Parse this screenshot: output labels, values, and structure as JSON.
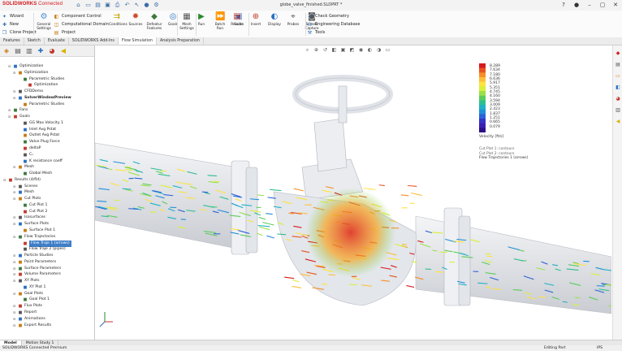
{
  "titlebar": {
    "logo_main": "SOLIDWORKS",
    "logo_rest": "Connected",
    "document_title": "globe_valve_finished.SLDPRT *"
  },
  "ribbon": {
    "left_commands": [
      "Wizard",
      "New",
      "Clone Project"
    ],
    "mid_commands": [
      "Component Control",
      "Computational Domain",
      "Project"
    ],
    "big_buttons": [
      {
        "label": "General Settings",
        "icon": "gear-icon"
      },
      {
        "label": "Conditions",
        "icon": "conditions-icon"
      },
      {
        "label": "Sources",
        "icon": "sources-icon"
      },
      {
        "label": "Defeatur Features",
        "icon": "defeature-icon"
      },
      {
        "label": "Goals",
        "icon": "goals-icon"
      },
      {
        "label": "Mesh Settings",
        "icon": "mesh-icon"
      },
      {
        "label": "Run",
        "icon": "run-icon"
      },
      {
        "label": "Batch Run",
        "icon": "batch-run-icon"
      },
      {
        "label": "Solve",
        "icon": "solve-icon"
      },
      {
        "label": "Results",
        "icon": "results-icon"
      },
      {
        "label": "Insert",
        "icon": "insert-icon"
      },
      {
        "label": "Display",
        "icon": "display-icon"
      },
      {
        "label": "Probes",
        "icon": "probes-icon"
      },
      {
        "label": "Screen Capture",
        "icon": "camera-icon"
      }
    ],
    "right_commands": [
      "Check Geometry",
      "Engineering Database",
      "Tools"
    ]
  },
  "tabs": [
    "Features",
    "Sketch",
    "Evaluate",
    "SOLIDWORKS Add-Ins",
    "Flow Simulation",
    "Analysis Preparation"
  ],
  "active_tab": "Flow Simulation",
  "tree": [
    {
      "label": "Optimization",
      "level": 1,
      "icon": "optimization-icon"
    },
    {
      "label": "Optimization",
      "level": 2,
      "icon": "folder-icon"
    },
    {
      "label": "Parametric Studies",
      "level": 3,
      "icon": "study-icon"
    },
    {
      "label": "Optimization",
      "level": 4,
      "icon": "study-icon"
    },
    {
      "label": "CFDDemo",
      "level": 2,
      "icon": "folder-icon"
    },
    {
      "label": "SolverWindowPreview",
      "level": 2,
      "icon": "folder-icon",
      "bold": true
    },
    {
      "label": "Parametric Studies",
      "level": 3,
      "icon": "study-icon"
    },
    {
      "label": "Fans",
      "level": 1,
      "icon": "fan-icon"
    },
    {
      "label": "Goals",
      "level": 1,
      "icon": "goals-icon"
    },
    {
      "label": "GG Max Velocity 1",
      "level": 3,
      "icon": "goal-item-icon"
    },
    {
      "label": "Inlet Avg Pstat",
      "level": 3,
      "icon": "goal-item-icon"
    },
    {
      "label": "Outlet Avg Pstat",
      "level": 3,
      "icon": "goal-item-icon"
    },
    {
      "label": "Valve Plug Force",
      "level": 3,
      "icon": "goal-item-icon"
    },
    {
      "label": "deltaP",
      "level": 3,
      "icon": "goal-item-icon"
    },
    {
      "label": "Cᵥ",
      "level": 3,
      "icon": "goal-item-icon"
    },
    {
      "label": "K resistance coeff",
      "level": 3,
      "icon": "goal-item-icon"
    },
    {
      "label": "Mesh",
      "level": 2,
      "icon": "mesh-icon"
    },
    {
      "label": "Global Mesh",
      "level": 3,
      "icon": "mesh-item-icon"
    },
    {
      "label": "Results (4/fld)",
      "level": 0,
      "icon": "results-icon"
    },
    {
      "label": "Scenes",
      "level": 2,
      "icon": "scenes-icon"
    },
    {
      "label": "Mesh",
      "level": 2,
      "icon": "mesh-icon"
    },
    {
      "label": "Cut Plots",
      "level": 2,
      "icon": "cutplot-icon"
    },
    {
      "label": "Cut Plot 1",
      "level": 3,
      "icon": "cutplot-item-icon"
    },
    {
      "label": "Cut Plot 2",
      "level": 3,
      "icon": "cutplot-item-icon"
    },
    {
      "label": "Isosurfaces",
      "level": 2,
      "icon": "isosurface-icon"
    },
    {
      "label": "Surface Plots",
      "level": 2,
      "icon": "surfaceplot-icon"
    },
    {
      "label": "Surface Plot 1",
      "level": 3,
      "icon": "surfaceplot-item-icon"
    },
    {
      "label": "Flow Trajectories",
      "level": 2,
      "icon": "trajectory-icon"
    },
    {
      "label": "Flow Traje 1 (arrows)",
      "level": 3,
      "icon": "trajectory-item-icon",
      "selected": true
    },
    {
      "label": "Flow Traje 2 (pipes)",
      "level": 3,
      "icon": "trajectory-item-icon"
    },
    {
      "label": "Particle Studies",
      "level": 2,
      "icon": "particle-icon"
    },
    {
      "label": "Point Parameters",
      "level": 2,
      "icon": "point-icon"
    },
    {
      "label": "Surface Parameters",
      "level": 2,
      "icon": "surface-param-icon"
    },
    {
      "label": "Volume Parameters",
      "level": 2,
      "icon": "volume-param-icon"
    },
    {
      "label": "XY Plots",
      "level": 2,
      "icon": "xyplot-icon"
    },
    {
      "label": "XY Plot 1",
      "level": 3,
      "icon": "xyplot-item-icon"
    },
    {
      "label": "Goal Plots",
      "level": 2,
      "icon": "goalplot-icon"
    },
    {
      "label": "Goal Plot 1",
      "level": 3,
      "icon": "goalplot-item-icon"
    },
    {
      "label": "Flux Plots",
      "level": 2,
      "icon": "fluxplot-icon"
    },
    {
      "label": "Report",
      "level": 2,
      "icon": "report-icon"
    },
    {
      "label": "Animations",
      "level": 2,
      "icon": "animation-icon"
    },
    {
      "label": "Export Results",
      "level": 2,
      "icon": "export-icon"
    }
  ],
  "legend": {
    "values": [
      "8.289",
      "7.634",
      "7.180",
      "6.636",
      "5.917",
      "5.351",
      "4.745",
      "4.160",
      "3.594",
      "3.009",
      "2.423",
      "1.837",
      "1.251",
      "0.665",
      "0.079"
    ],
    "title": "Velocity [ft/s]",
    "colors": [
      "#d7191c",
      "#e8531f",
      "#f6902a",
      "#fdbf3b",
      "#fee33c",
      "#d9f03a",
      "#9be04a",
      "#5ccc5c",
      "#2fbf8f",
      "#1fb1c4",
      "#1f8fd9",
      "#2a62d8",
      "#3535c8",
      "#3b1fb0",
      "#2d0f8a"
    ],
    "entries": [
      "Cut Plot 1: contours",
      "Cut Plot 2: contours",
      "Flow Trajectories 1 (arrows)"
    ]
  },
  "bottom_tabs": [
    "Model",
    "Motion Study 1"
  ],
  "status": {
    "left": "SOLIDWORKS Connected Premium",
    "editing": "Editing Part",
    "units": "IPS"
  }
}
